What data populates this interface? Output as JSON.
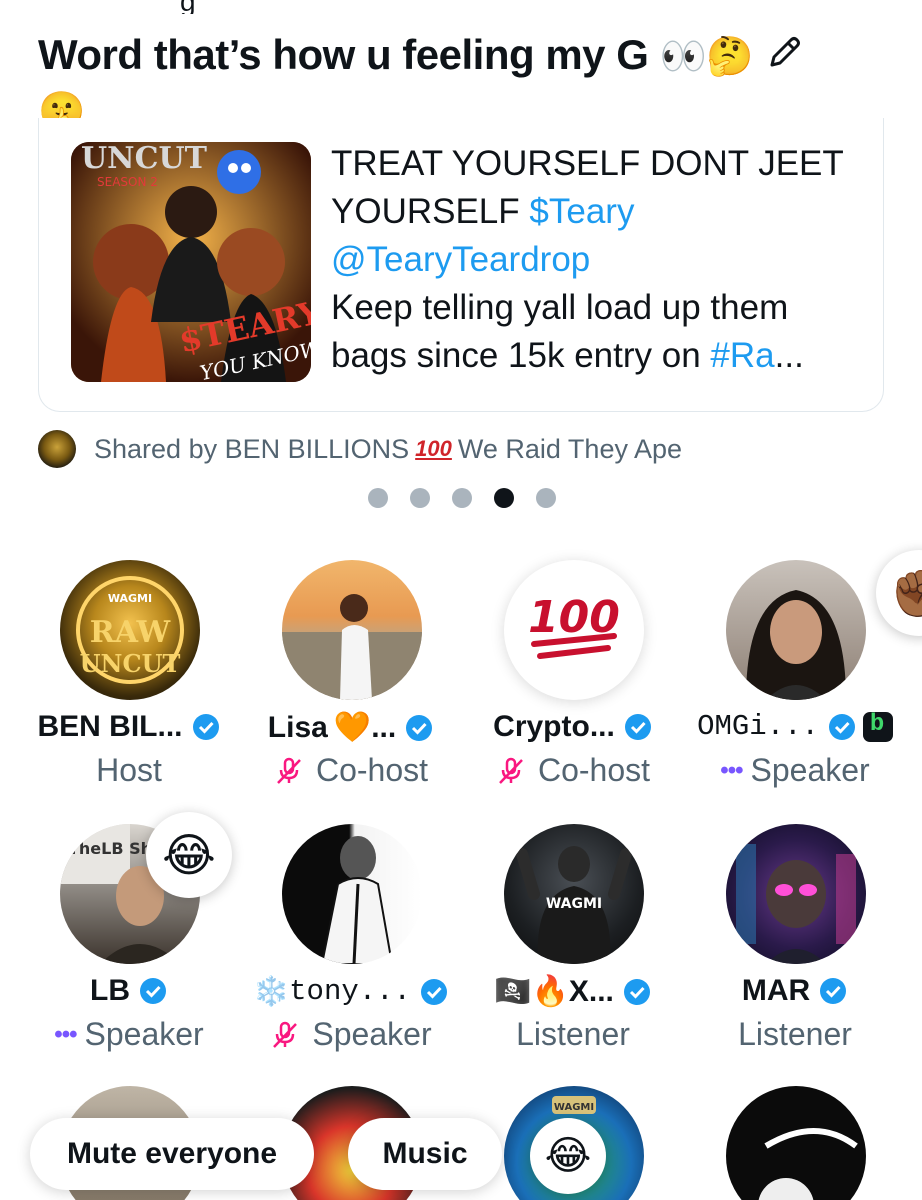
{
  "post": {
    "title_text": "Word that’s how u feeling my G",
    "title_emojis_a": "👀🤔",
    "title_emoji_b": "🤫"
  },
  "card": {
    "line1": "TREAT YOURSELF DONT JEET",
    "line2a": "YOURSELF ",
    "cashtag": "$Teary",
    "mention": "@TearyTeardrop",
    "line4": "Keep telling yall load up them",
    "line5a": "bags since 15k entry on ",
    "hashtag": "#Ra",
    "ellipsis": "...",
    "art_text_top": "UNCUT",
    "art_text_sub": "SEASON 2",
    "art_text_mid": "$TEARY",
    "art_text_bot": "YOU KNOW"
  },
  "shared": {
    "prefix": "Shared by BEN BILLIONS",
    "hundred": "100",
    "suffix": "We Raid They Ape"
  },
  "carousel": {
    "count": 5,
    "active_index": 3
  },
  "participants": [
    {
      "name": "BEN BIL...",
      "role": "Host",
      "verified": true
    },
    {
      "name": "Lisa",
      "name_emoji": "🧡",
      "name_tail": " ...",
      "role": "Co-host",
      "muted": true,
      "verified": true
    },
    {
      "name": "Crypto...",
      "role": "Co-host",
      "muted": true,
      "verified": true,
      "avatar_text": "100"
    },
    {
      "name": "OMGi...",
      "role": "Speaker",
      "speaking": true,
      "verified": true,
      "reaction": "✊🏾"
    },
    {
      "name": "LB",
      "role": "Speaker",
      "speaking": true,
      "verified": true,
      "reaction": "😂",
      "avatar_text": "TheLB Show"
    },
    {
      "name_emoji": "❄️",
      "name": "tony...",
      "role": "Speaker",
      "muted": true,
      "verified": true
    },
    {
      "name_emoji": "🏴‍☠️🔥",
      "name": "X...",
      "role": "Listener",
      "verified": true,
      "avatar_text": "WAGMI"
    },
    {
      "name": "MAR",
      "role": "Listener",
      "verified": true
    }
  ],
  "bottom": {
    "mute_label": "Mute everyone",
    "music_label": "Music",
    "reaction": "😂",
    "partial_badge_text": "WAGMI"
  },
  "speaker_dots": "•••",
  "colors": {
    "link": "#1d9bf0",
    "verified": "#1d9bf0",
    "muted_mic": "#f91880",
    "speaking": "#7856ff",
    "hundred": "#d0242a"
  }
}
